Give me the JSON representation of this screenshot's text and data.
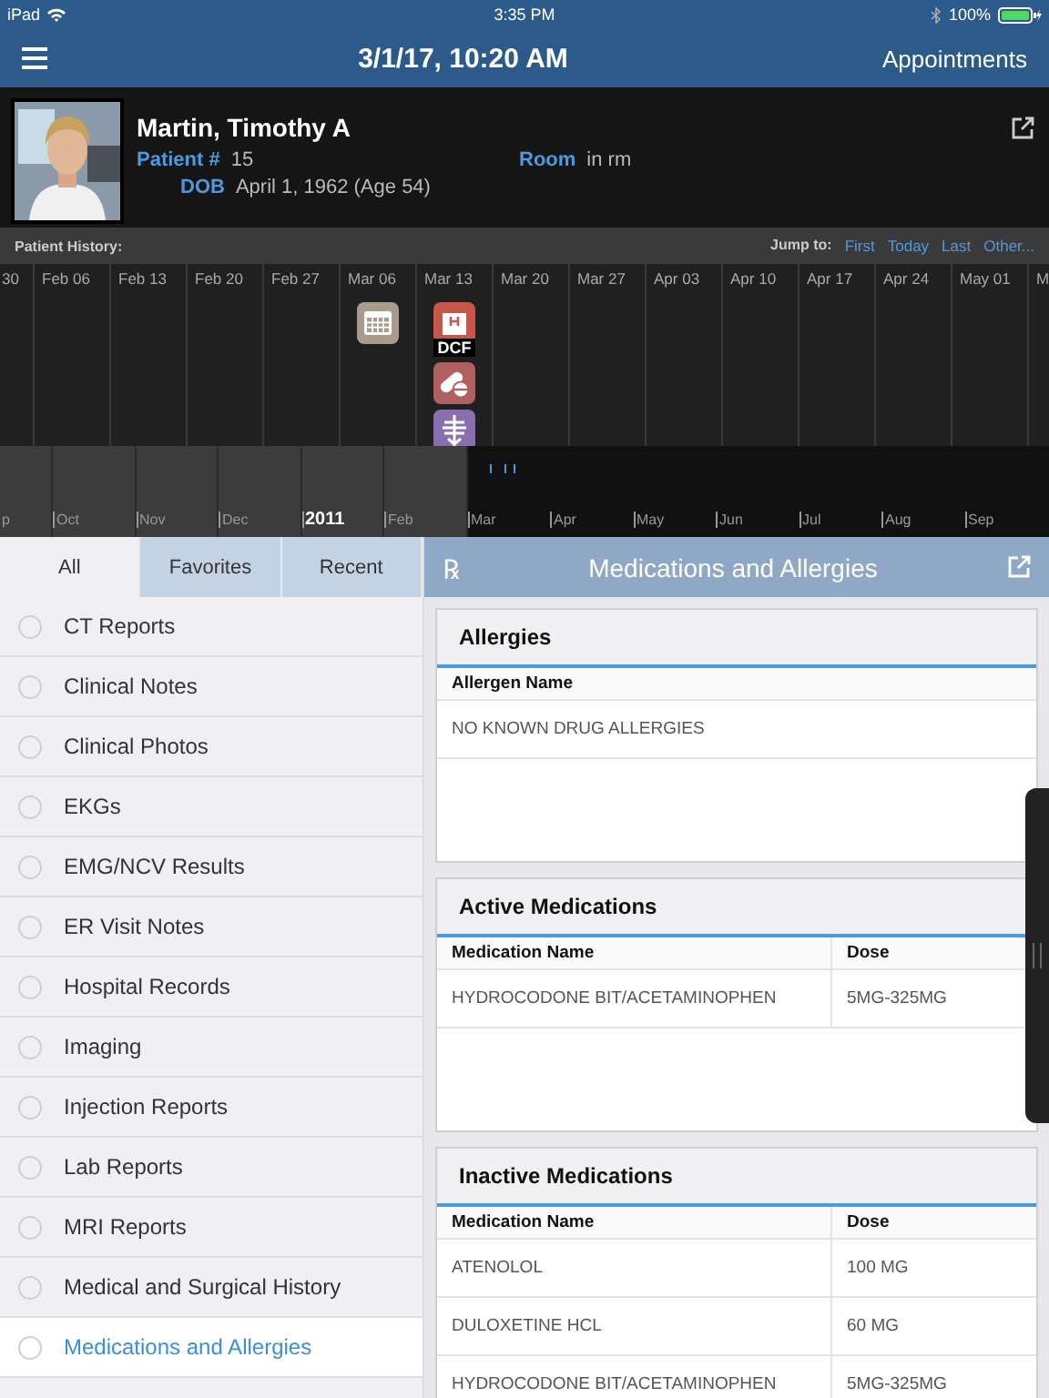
{
  "status_bar": {
    "device": "iPad",
    "time": "3:35 PM",
    "battery": "100%"
  },
  "nav_bar": {
    "title": "3/1/17, 10:20 AM",
    "action": "Appointments"
  },
  "patient": {
    "name": "Martin, Timothy A",
    "fields": [
      {
        "label": "Patient #",
        "value": "15"
      },
      {
        "label": "Room",
        "value": "in rm"
      },
      {
        "label": "DOB",
        "value": "April 1, 1962 (Age 54)"
      }
    ]
  },
  "history": {
    "title": "Patient History:",
    "jump_label": "Jump to:",
    "jump_links": [
      "First",
      "Today",
      "Last",
      "Other..."
    ],
    "weeks": [
      {
        "label": "30"
      },
      {
        "label": "Feb 06"
      },
      {
        "label": "Feb 13"
      },
      {
        "label": "Feb 20"
      },
      {
        "label": "Feb 27"
      },
      {
        "label": "Mar 06",
        "events": [
          {
            "kind": "appointment"
          }
        ]
      },
      {
        "label": "Mar 13",
        "events": [
          {
            "kind": "hospital",
            "caption": "DCF"
          },
          {
            "kind": "medication"
          },
          {
            "kind": "xray"
          }
        ]
      },
      {
        "label": "Mar 20"
      },
      {
        "label": "Mar 27"
      },
      {
        "label": "Apr 03"
      },
      {
        "label": "Apr 10"
      },
      {
        "label": "Apr 17"
      },
      {
        "label": "Apr 24"
      },
      {
        "label": "May 01"
      },
      {
        "label": "M"
      }
    ],
    "months": [
      {
        "label": "p",
        "kind": "month",
        "highlighted": true,
        "marks": false
      },
      {
        "label": "Oct",
        "kind": "month",
        "highlighted": true,
        "marks": false
      },
      {
        "label": "Nov",
        "kind": "month",
        "highlighted": true,
        "marks": false
      },
      {
        "label": "Dec",
        "kind": "month",
        "highlighted": true,
        "marks": false
      },
      {
        "label": "2011",
        "kind": "year",
        "highlighted": true,
        "marks": false
      },
      {
        "label": "Feb",
        "kind": "month",
        "highlighted": true,
        "marks": false
      },
      {
        "label": "Mar",
        "kind": "month",
        "highlighted": false,
        "marks": true
      },
      {
        "label": "Apr",
        "kind": "month",
        "highlighted": false,
        "marks": false
      },
      {
        "label": "May",
        "kind": "month",
        "highlighted": false,
        "marks": false
      },
      {
        "label": "Jun",
        "kind": "month",
        "highlighted": false,
        "marks": false
      },
      {
        "label": "Jul",
        "kind": "month",
        "highlighted": false,
        "marks": false
      },
      {
        "label": "Aug",
        "kind": "month",
        "highlighted": false,
        "marks": false
      },
      {
        "label": "Sep",
        "kind": "month",
        "highlighted": false,
        "marks": false
      }
    ]
  },
  "tabs": [
    {
      "label": "All",
      "selected": true
    },
    {
      "label": "Favorites",
      "selected": false
    },
    {
      "label": "Recent",
      "selected": false
    }
  ],
  "categories": [
    {
      "label": "CT Reports",
      "selected": false
    },
    {
      "label": "Clinical Notes",
      "selected": false
    },
    {
      "label": "Clinical Photos",
      "selected": false
    },
    {
      "label": "EKGs",
      "selected": false
    },
    {
      "label": "EMG/NCV Results",
      "selected": false
    },
    {
      "label": "ER Visit Notes",
      "selected": false
    },
    {
      "label": "Hospital Records",
      "selected": false
    },
    {
      "label": "Imaging",
      "selected": false
    },
    {
      "label": "Injection Reports",
      "selected": false
    },
    {
      "label": "Lab Reports",
      "selected": false
    },
    {
      "label": "MRI Reports",
      "selected": false
    },
    {
      "label": "Medical and Surgical History",
      "selected": false
    },
    {
      "label": "Medications and Allergies",
      "selected": true
    }
  ],
  "panel": {
    "icon_text": "℞",
    "title": "Medications and Allergies",
    "sections": [
      {
        "title": "Allergies",
        "columns": [
          "Allergen Name"
        ],
        "rows": [
          [
            "NO KNOWN DRUG ALLERGIES"
          ]
        ],
        "empty_space": true
      },
      {
        "title": "Active Medications",
        "columns": [
          "Medication Name",
          "Dose"
        ],
        "rows": [
          [
            "HYDROCODONE BIT/ACETAMINOPHEN",
            "5MG-325MG"
          ]
        ],
        "empty_space": true
      },
      {
        "title": "Inactive Medications",
        "columns": [
          "Medication Name",
          "Dose"
        ],
        "rows": [
          [
            "ATENOLOL",
            "100 MG"
          ],
          [
            "DULOXETINE HCL",
            "60 MG"
          ],
          [
            "HYDROCODONE BIT/ACETAMINOPHEN",
            "5MG-325MG"
          ]
        ],
        "empty_space": false
      }
    ]
  }
}
